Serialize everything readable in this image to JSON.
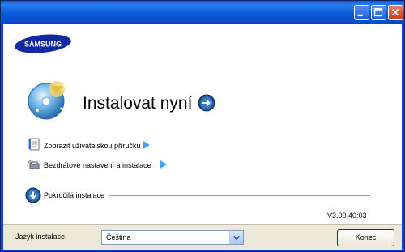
{
  "window": {
    "controls": [
      "minimize-icon",
      "maximize-icon",
      "close-icon"
    ]
  },
  "brand": {
    "logo_text": "SAMSUNG"
  },
  "main": {
    "install_now": "Instalovat nyní",
    "links": [
      {
        "label": "Zobrazit uživatelskou příručku",
        "icon": "manual-book-icon"
      },
      {
        "label": "Bezdrátové nastavení a instalace",
        "icon": "wireless-printer-icon"
      }
    ],
    "advanced_label": "Pokročilá instalace",
    "version": "V3.00.40:03"
  },
  "footer": {
    "language_label": "Jazyk instalace:",
    "language_value": "Čeština",
    "cancel_button": "Konec"
  },
  "colors": {
    "titlebar": "#0b59d8",
    "samsung_blue": "#1428a0",
    "link_arrow": "#4a9ff5",
    "footer_bg": "#ece9d8"
  }
}
